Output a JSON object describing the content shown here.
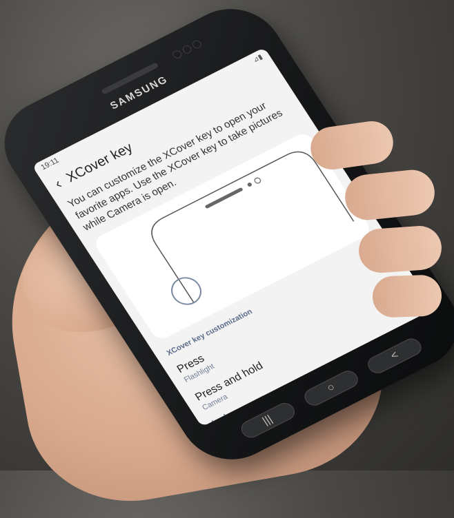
{
  "device": {
    "brand": "SAMSUNG"
  },
  "status_bar": {
    "time": "19:11",
    "right_icons": "⊿▮"
  },
  "settings_screen": {
    "title": "XCover key",
    "description": "You can customize the XCover key to open your favorite apps. Use the XCover key to take pictures while Camera is open.",
    "section_title": "XCover key customization",
    "options": [
      {
        "title": "Press",
        "subtitle": "Flashlight"
      },
      {
        "title": "Press and hold",
        "subtitle": "Camera"
      }
    ],
    "lock_section_title": "Lock screen"
  },
  "navigation": {
    "recents_glyph": "|||",
    "home_glyph": "○",
    "back_glyph": "<"
  },
  "colors": {
    "screen_bg": "#f3f3f3",
    "card_bg": "#ffffff",
    "section_title": "#5a6c8a",
    "phone_body": "#141516"
  },
  "icons": [
    "back-arrow-icon",
    "xcover-key-highlight-icon",
    "recents-icon",
    "home-icon",
    "back-nav-icon"
  ]
}
